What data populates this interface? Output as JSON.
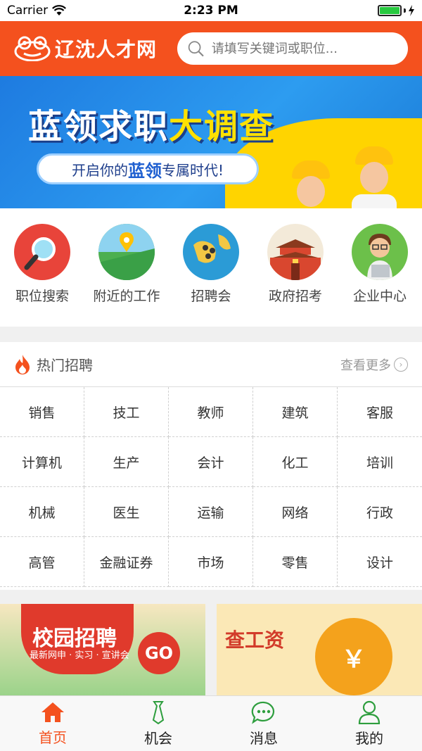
{
  "status_bar": {
    "carrier": "Carrier",
    "time": "2:23 PM"
  },
  "header": {
    "logo_text": "辽沈人才网",
    "search_placeholder": "请填写关键词或职位..."
  },
  "banner": {
    "title_part1": "蓝领求职",
    "title_part2": "大调查",
    "subtitle_pre": "开启你的",
    "subtitle_bold": "蓝领",
    "subtitle_post": "专属时代!"
  },
  "quick_nav": [
    {
      "label": "职位搜索",
      "icon": "magnifier-icon",
      "color": "#e8443a"
    },
    {
      "label": "附近的工作",
      "icon": "map-pin-icon",
      "color": "#4caf50"
    },
    {
      "label": "招聘会",
      "icon": "globe-icon",
      "color": "#2b9bd6"
    },
    {
      "label": "政府招考",
      "icon": "tiananmen-icon",
      "color": "#cc3a2a"
    },
    {
      "label": "企业中心",
      "icon": "person-laptop-icon",
      "color": "#6cc04a"
    }
  ],
  "hot": {
    "title": "热门招聘",
    "more": "查看更多",
    "categories": [
      "销售",
      "技工",
      "教师",
      "建筑",
      "客服",
      "计算机",
      "生产",
      "会计",
      "化工",
      "培训",
      "机械",
      "医生",
      "运输",
      "网络",
      "行政",
      "高管",
      "金融证券",
      "市场",
      "零售",
      "设计"
    ]
  },
  "promos": {
    "campus_title": "校园招聘",
    "campus_sub": "最新网申 · 实习 · 宣讲会",
    "campus_go": "GO",
    "salary_title": "查工资",
    "salary_symbol": "￥"
  },
  "tabs": [
    {
      "label": "首页",
      "icon": "home-icon",
      "active": true
    },
    {
      "label": "机会",
      "icon": "tie-icon",
      "active": false
    },
    {
      "label": "消息",
      "icon": "chat-bubble-icon",
      "active": false
    },
    {
      "label": "我的",
      "icon": "user-icon",
      "active": false
    }
  ],
  "colors": {
    "brand": "#f4511e",
    "tab_active": "#f4511e",
    "icon_green": "#2e9e3e"
  }
}
